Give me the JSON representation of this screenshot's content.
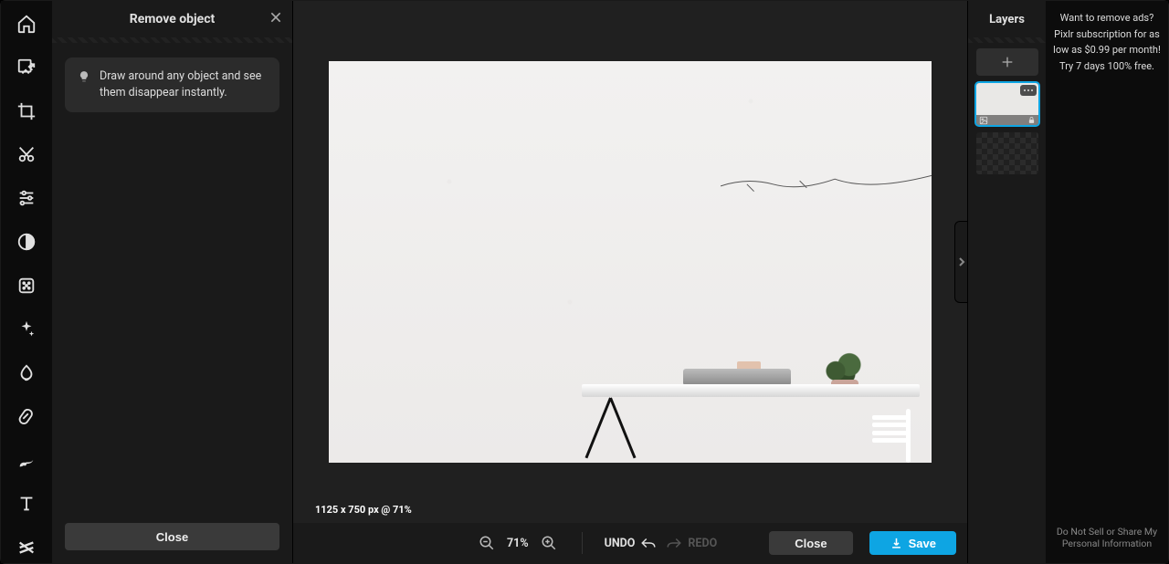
{
  "panel": {
    "title": "Remove object",
    "tip": "Draw around any object and see them disappear instantly.",
    "close_label": "Close"
  },
  "canvas": {
    "dims": "1125 x 750 px @ 71%"
  },
  "bottom": {
    "zoom": "71%",
    "undo": "UNDO",
    "redo": "REDO",
    "close": "Close",
    "save": "Save"
  },
  "layers": {
    "title": "Layers"
  },
  "ads": {
    "line1": "Want to remove ads?",
    "line2": "Pixlr subscription for as low as $0.99 per month!",
    "line3": "Try 7 days 100% free.",
    "footer": "Do Not Sell or Share My Personal Information"
  },
  "tools": [
    "home-icon",
    "arrange-icon",
    "crop-icon",
    "cutout-icon",
    "adjust-icon",
    "contrast-icon",
    "filter-icon",
    "ai-icon",
    "liquify-icon",
    "retouch-icon",
    "draw-icon",
    "text-icon",
    "element-icon"
  ]
}
